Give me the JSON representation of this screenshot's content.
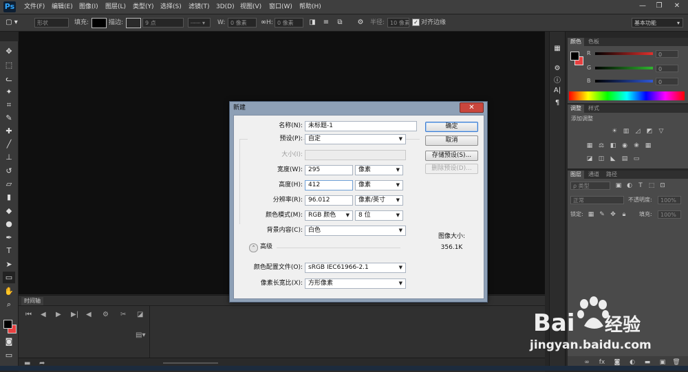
{
  "app": {
    "logo": "Ps",
    "menus": [
      "文件(F)",
      "编辑(E)",
      "图像(I)",
      "图层(L)",
      "类型(Y)",
      "选择(S)",
      "滤镜(T)",
      "3D(D)",
      "视图(V)",
      "窗口(W)",
      "帮助(H)"
    ],
    "window_controls": [
      "—",
      "❐",
      "✕"
    ]
  },
  "options": {
    "mode_label": "形状",
    "fill_label": "填充:",
    "stroke_label": "描边:",
    "stroke_width": "9 点",
    "w_label": "W:",
    "w_value": "0 像素",
    "link_icon": "link-icon",
    "h_label": "H:",
    "h_value": "0 像素",
    "radius_label": "半径:",
    "radius_value": "10 像素",
    "align_edges_label": "对齐边缘",
    "workspace": "基本功能"
  },
  "timeline": {
    "tab": "时间轴"
  },
  "color_panel": {
    "tabs": [
      "颜色",
      "色板"
    ],
    "r_label": "R",
    "g_label": "G",
    "b_label": "B",
    "r_value": "0",
    "g_value": "0",
    "b_value": "0",
    "colors": {
      "r": "#e0302c",
      "g": "#2fb52f",
      "b": "#2f58d6",
      "fg": "#000000",
      "bg": "#e84040"
    }
  },
  "adjust_panel": {
    "tabs": [
      "调整",
      "样式"
    ],
    "add_label": "添加调整"
  },
  "layers_panel": {
    "tabs": [
      "图层",
      "通道",
      "路径"
    ],
    "filter_label": "ρ 类型",
    "blend_mode": "正常",
    "opacity_label": "不透明度:",
    "opacity_value": "100%",
    "lock_label": "锁定:",
    "fill_label": "填充:",
    "fill_value": "100%"
  },
  "dialog": {
    "title": "新建",
    "close": "✕",
    "name_label": "名称(N):",
    "name_value": "未标题-1",
    "preset_label": "预设(P):",
    "preset_value": "自定",
    "size_label": "大小(I):",
    "width_label": "宽度(W):",
    "width_value": "295",
    "width_unit": "像素",
    "height_label": "高度(H):",
    "height_value": "412",
    "height_unit": "像素",
    "resolution_label": "分辨率(R):",
    "resolution_value": "96.012",
    "resolution_unit": "像素/英寸",
    "color_mode_label": "颜色模式(M):",
    "color_mode_value": "RGB 颜色",
    "bit_depth_value": "8 位",
    "background_label": "背景内容(C):",
    "background_value": "白色",
    "advanced_label": "高级",
    "color_profile_label": "颜色配置文件(O):",
    "color_profile_value": "sRGB IEC61966-2.1",
    "pixel_aspect_label": "像素长宽比(X):",
    "pixel_aspect_value": "方形像素",
    "ok_button": "确定",
    "cancel_button": "取消",
    "save_preset_button": "存储预设(S)...",
    "delete_preset_button": "删除预设(D)...",
    "image_size_label": "图像大小:",
    "image_size_value": "356.1K"
  },
  "watermark": {
    "logo_text_1": "Bai",
    "logo_text_2": "经验",
    "url": "jingyan.baidu.com"
  }
}
